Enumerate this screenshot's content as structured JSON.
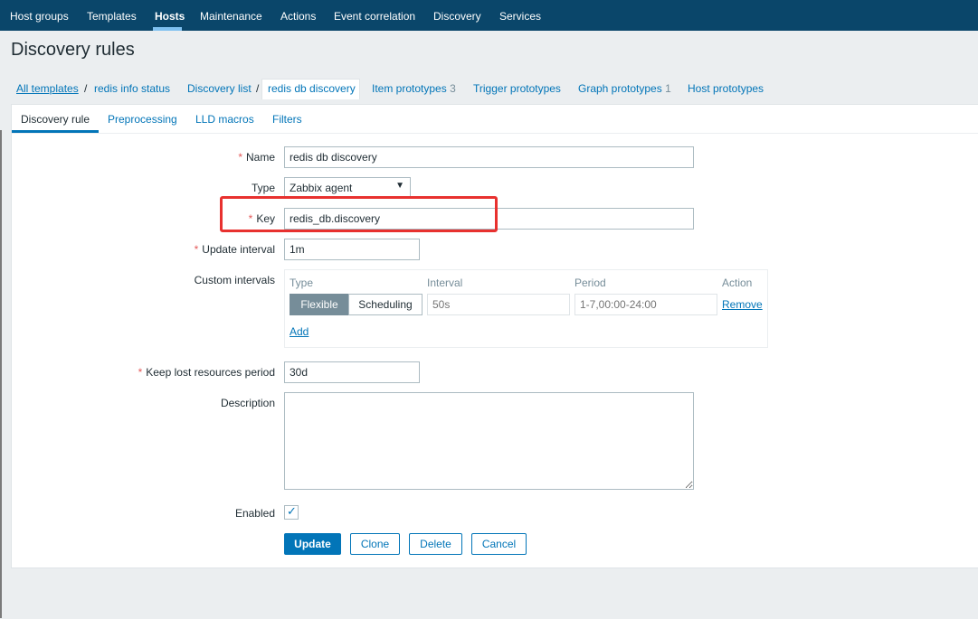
{
  "nav": {
    "items": [
      "Host groups",
      "Templates",
      "Hosts",
      "Maintenance",
      "Actions",
      "Event correlation",
      "Discovery",
      "Services"
    ]
  },
  "page_title": "Discovery rules",
  "breadcrumb": {
    "all_templates": "All templates",
    "sep": "/",
    "template": "redis info status",
    "discovery_list": "Discovery list",
    "current": "redis db discovery",
    "item_prototypes": "Item prototypes",
    "item_prototypes_count": "3",
    "trigger_prototypes": "Trigger prototypes",
    "graph_prototypes": "Graph prototypes",
    "graph_prototypes_count": "1",
    "host_prototypes": "Host prototypes"
  },
  "tabs": [
    "Discovery rule",
    "Preprocessing",
    "LLD macros",
    "Filters"
  ],
  "form": {
    "required_mark": "*",
    "name_label": "Name",
    "name_value": "redis db discovery",
    "type_label": "Type",
    "type_value": "Zabbix agent",
    "type_arrow": "▼",
    "key_label": "Key",
    "key_value": "redis_db.discovery",
    "update_interval_label": "Update interval",
    "update_interval_value": "1m",
    "custom_intervals_label": "Custom intervals",
    "ci_headers": {
      "type": "Type",
      "interval": "Interval",
      "period": "Period",
      "action": "Action"
    },
    "ci_flexible": "Flexible",
    "ci_scheduling": "Scheduling",
    "ci_interval_placeholder": "50s",
    "ci_period_placeholder": "1-7,00:00-24:00",
    "ci_remove": "Remove",
    "ci_add": "Add",
    "keep_lost_label": "Keep lost resources period",
    "keep_lost_value": "30d",
    "description_label": "Description",
    "description_value": "",
    "enabled_label": "Enabled",
    "enabled_mark": "✓"
  },
  "buttons": {
    "update": "Update",
    "clone": "Clone",
    "delete": "Delete",
    "cancel": "Cancel"
  },
  "colors": {
    "nav_bg": "#0a466a",
    "link": "#0275b8",
    "required": "#e45959",
    "highlight": "#e8312f"
  }
}
